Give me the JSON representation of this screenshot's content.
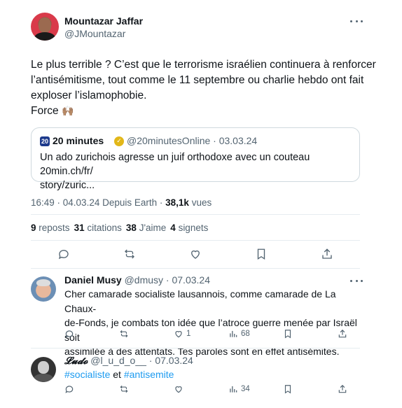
{
  "tweet": {
    "author_name": "Mountazar Jaffar",
    "author_handle": "@JMountazar",
    "lines": [
      "Le plus terrible ? C’est que le terrorisme israélien continuera à renforcer",
      "l’antisémitisme, tout comme le 11 septembre ou charlie hebdo ont fait",
      "exploser l’islamophobie.",
      "Force"
    ],
    "emoji": "🙌🏽",
    "quote": {
      "logo": "20",
      "name": "20 minutes",
      "handle_date": "@20minutesOnline · 03.03.24",
      "text_line1": "Un ado zurichois agresse un juif orthodoxe avec un couteau 20min.ch/fr/",
      "text_line2": "story/zuric..."
    },
    "time": "16:49 · 04.03.24",
    "source": "Depuis Earth",
    "views_count": "38,1k",
    "views_label": "vues",
    "stats": {
      "reposts_count": "9",
      "reposts_label": "reposts",
      "citations_count": "31",
      "citations_label": "citations",
      "likes_count": "38",
      "likes_label": "J'aime",
      "bookmarks_count": "4",
      "bookmarks_label": "signets"
    }
  },
  "replies": [
    {
      "name": "Daniel Musy",
      "meta": "@dmusy · 07.03.24",
      "lines": [
        "Cher camarade socialiste lausannois, comme camarade de La Chaux-",
        "de-Fonds, je combats ton idée que l’atroce guerre menée par Israël soit",
        "assimilée à des attentats. Tes paroles sont en effet antisémites."
      ],
      "likes": "1",
      "views": "68"
    },
    {
      "name": "𝓛𝓾𝓭𝓸",
      "meta": "@l_u_d_o__ · 07.03.24",
      "hashtag1": "#socialiste",
      "connector": "et",
      "hashtag2": "#antisemite",
      "views": "34"
    }
  ],
  "icons": {
    "reply": "reply-icon",
    "repost": "repost-icon",
    "like": "heart-icon",
    "bookmark": "bookmark-icon",
    "share": "share-icon",
    "views": "views-icon",
    "more": "more-icon"
  },
  "colors": {
    "accent": "#1d9bf0",
    "muted": "#536471",
    "border": "#cfd9de"
  }
}
